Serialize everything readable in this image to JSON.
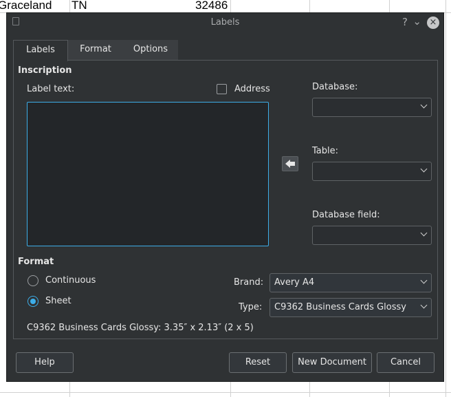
{
  "spreadsheet": {
    "cells": [
      "Graceland",
      "TN",
      "32486"
    ]
  },
  "dialog": {
    "title": "Labels"
  },
  "titlebar": {
    "help": "?",
    "minimize": "⌄",
    "close": "×"
  },
  "tabs": [
    "Labels",
    "Format",
    "Options"
  ],
  "inscription": {
    "heading": "Inscription",
    "label_text": "Label text:",
    "address": "Address",
    "address_checked": false,
    "text_value": ""
  },
  "database": {
    "database_label": "Database:",
    "database_value": "",
    "table_label": "Table:",
    "table_value": "",
    "field_label": "Database field:",
    "field_value": ""
  },
  "format": {
    "heading": "Format",
    "continuous": "Continuous",
    "sheet": "Sheet",
    "selected": "sheet",
    "brand_label": "Brand:",
    "brand_value": "Avery A4",
    "type_label": "Type:",
    "type_value": "C9362 Business Cards Glossy",
    "summary": "C9362 Business Cards Glossy: 3.35″ x 2.13″ (2 x 5)"
  },
  "buttons": {
    "help": "Help",
    "reset": "Reset",
    "new_document": "New Document",
    "cancel": "Cancel"
  }
}
